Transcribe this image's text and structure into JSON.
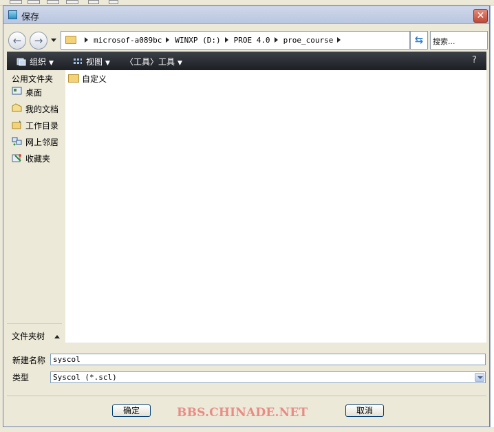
{
  "window": {
    "title": "保存",
    "close_symbol": "✕"
  },
  "address": {
    "crumbs": [
      "microsof-a089bc",
      "WINXP (D:)",
      "PROE 4.0",
      "proe_course"
    ],
    "search_placeholder": "搜索..."
  },
  "toolbar": {
    "organize": "组织",
    "view": "视图",
    "tools": "〈工具〉工具"
  },
  "sidebar": {
    "header": "公用文件夹",
    "items": [
      {
        "label": "桌面",
        "icon": "desktop-icon"
      },
      {
        "label": "我的文档",
        "icon": "documents-icon"
      },
      {
        "label": "工作目录",
        "icon": "working-dir-icon"
      },
      {
        "label": "网上邻居",
        "icon": "network-icon"
      },
      {
        "label": "收藏夹",
        "icon": "favorites-icon"
      }
    ],
    "footer": "文件夹树"
  },
  "files": [
    {
      "name": "自定义",
      "type": "folder"
    }
  ],
  "form": {
    "name_label": "新建名称",
    "name_value": "syscol",
    "type_label": "类型",
    "type_value": "Syscol (*.scl)"
  },
  "buttons": {
    "ok": "确定",
    "cancel": "取消"
  },
  "watermark": "BBS.CHINADE.NET",
  "colors": {
    "accent": "#1c1f24",
    "watermark": "#e88c85"
  }
}
